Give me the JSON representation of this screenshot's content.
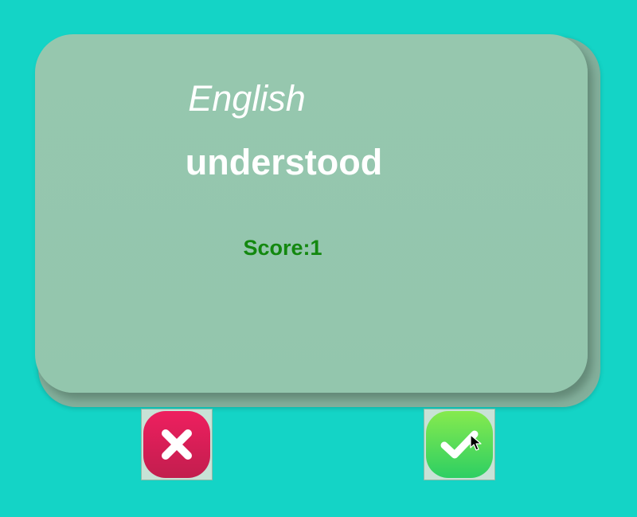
{
  "card": {
    "language": "English",
    "word": "understood",
    "score_text": "Score:1"
  },
  "buttons": {
    "reject": {
      "icon": "close-icon",
      "color": "#e01e58"
    },
    "accept": {
      "icon": "checkmark-icon",
      "color": "#4fd95a"
    }
  },
  "colors": {
    "background": "#14d4c6",
    "card": "#96c7ae",
    "score": "#13880f"
  }
}
